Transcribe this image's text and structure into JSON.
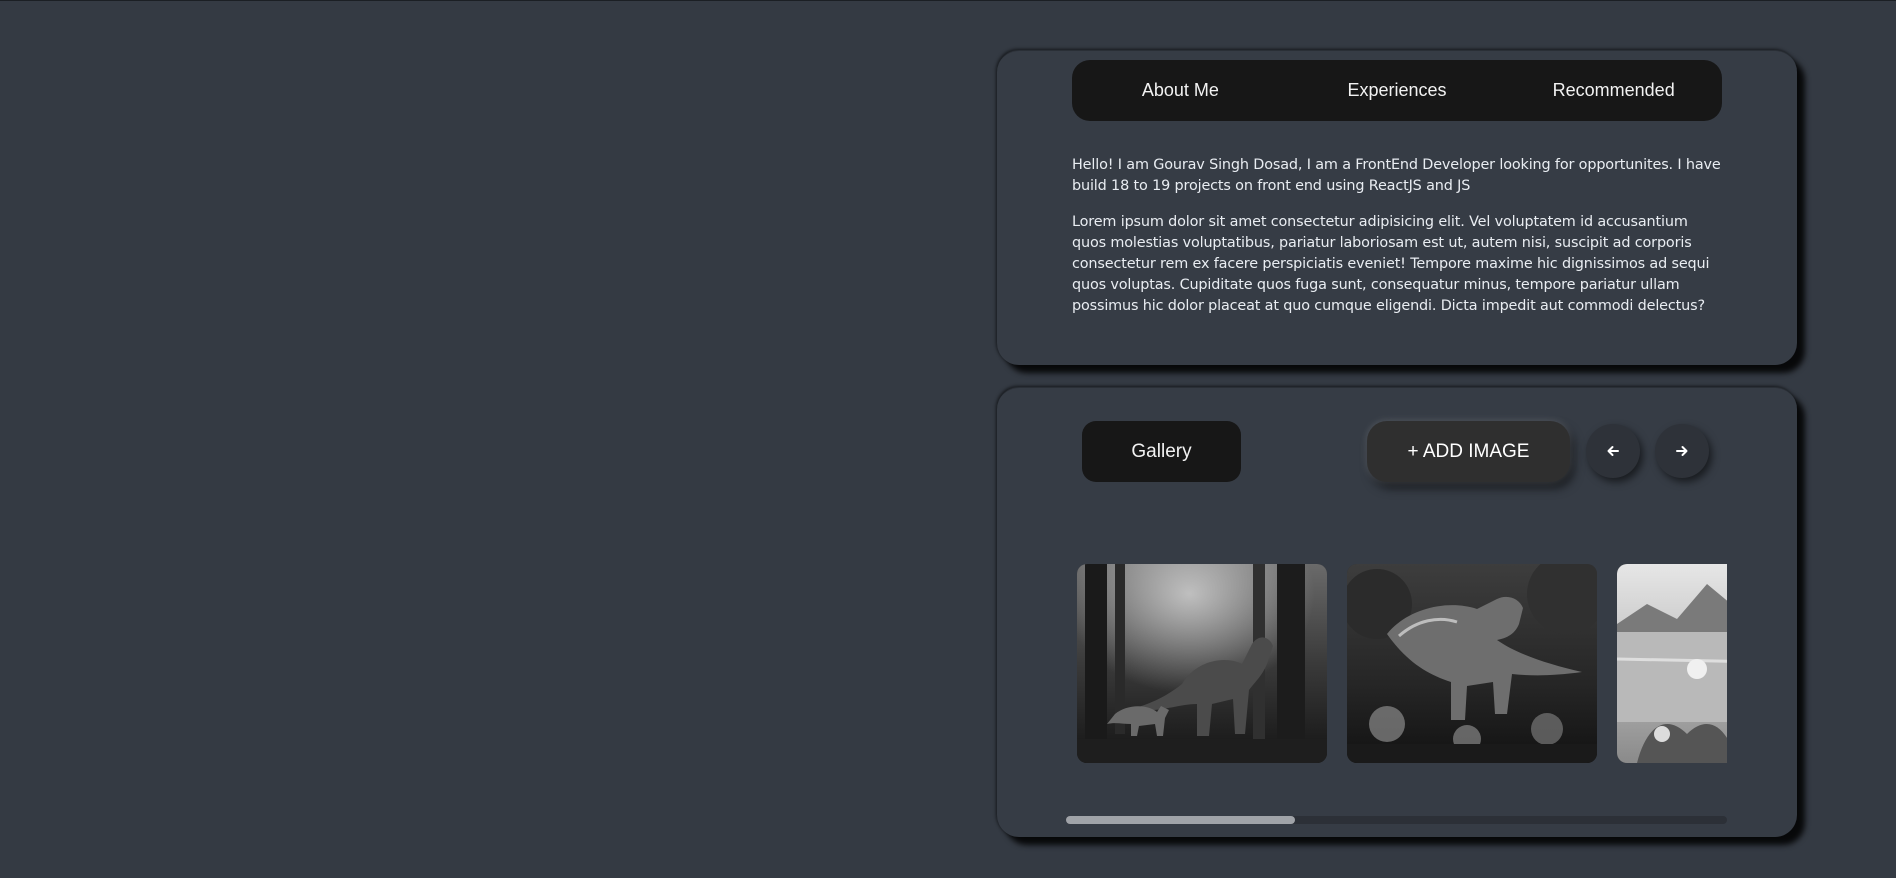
{
  "tabs": [
    {
      "label": "About Me"
    },
    {
      "label": "Experiences"
    },
    {
      "label": "Recommended"
    }
  ],
  "about": {
    "paragraph1": "Hello! I am Gourav Singh Dosad, I am a FrontEnd Developer looking for opportunites. I have build 18 to 19 projects on front end using ReactJS and JS",
    "paragraph2": "Lorem ipsum dolor sit amet consectetur adipisicing elit. Vel voluptatem id accusantium quos molestias voluptatibus, pariatur laboriosam est ut, autem nisi, suscipit ad corporis consectetur rem ex facere perspiciatis eveniet! Tempore maxime hic dignissimos ad sequi quos voluptas. Cupiditate quos fuga sunt, consequatur minus, tempore pariatur ullam possimus hic dolor placeat at quo cumque eligendi. Dicta impedit aut commodi delectus?"
  },
  "gallery": {
    "title": "Gallery",
    "add_label": "+ ADD IMAGE",
    "prev_icon": "arrow-left-icon",
    "next_icon": "arrow-right-icon",
    "images": [
      {
        "subject": "dinosaur-forest"
      },
      {
        "subject": "dinosaur-jungle"
      },
      {
        "subject": "mountain-lake"
      }
    ],
    "scroll_position_fraction": 0.35
  },
  "colors": {
    "background": "#343a43",
    "card": "#363c45",
    "pill": "#171717",
    "text": "#f2f2f2"
  }
}
